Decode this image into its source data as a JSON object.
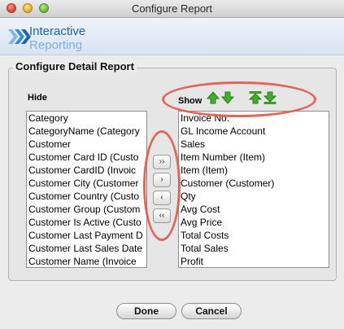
{
  "window": {
    "title": "Configure Report"
  },
  "brand": {
    "line1": "Interactive",
    "line2": "Reporting"
  },
  "section": {
    "title": "Configure Detail Report"
  },
  "hide_list": {
    "label": "Hide",
    "items": [
      "Category",
      "CategoryName (Category",
      "Customer",
      "Customer Card ID (Custo",
      "Customer CardID (Invoic",
      "Customer City (Customer",
      "Customer Country (Custo",
      "Customer Group (Custom",
      "Customer Is Active (Custo",
      "Customer Last Payment D",
      "Customer Last Sales Date",
      "Customer Name (Invoice"
    ]
  },
  "show_list": {
    "label": "Show",
    "items": [
      "Invoice No.",
      "GL Income Account",
      "Sales",
      "Item Number (Item)",
      "Item (Item)",
      "Customer (Customer)",
      "Qty",
      "Avg Cost",
      "Avg Price",
      "Total Costs",
      "Total Sales",
      "Profit"
    ]
  },
  "move_buttons": {
    "all_right": "››",
    "right": "›",
    "left": "‹",
    "all_left": "‹‹"
  },
  "icons": {
    "order": [
      "move-up-icon",
      "move-down-icon",
      "move-to-top-icon",
      "move-to-bottom-icon"
    ],
    "color": "#3fae2a"
  },
  "buttons": {
    "done": "Done",
    "cancel": "Cancel"
  }
}
